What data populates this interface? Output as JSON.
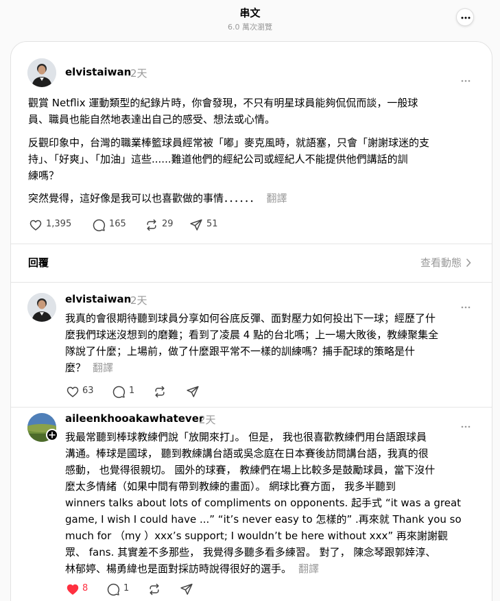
{
  "header": {
    "title": "串文",
    "views": "6.0 萬次瀏覽"
  },
  "post": {
    "username": "elvistaiwan",
    "time": "2天",
    "paragraphs": [
      [
        "觀賞 Netflix 運動類型的紀錄片時，你會發現，不只有明星球員能夠侃侃而談，一般球",
        "員、職員也能自然地表達出自己的感受、想法或心情。"
      ],
      [
        "反觀印象中，台灣的職業棒籃球員經常被「嘟」麥克風時，就語塞，只會「謝謝球迷的支",
        "持」、「好爽」、「加油」這些......難道他們的經紀公司或經紀人不能提供他們講話的訓",
        "練嗎？"
      ],
      [
        "突然覺得，這好像是我可以也喜歡做的事情．．．．．．"
      ]
    ],
    "translate": "翻譯",
    "likes": "1,395",
    "comments": "165",
    "reposts": "29",
    "shares": "51"
  },
  "replies_section": {
    "label": "回覆",
    "activity": "查看動態"
  },
  "replies": [
    {
      "username": "elvistaiwan",
      "time": "2天",
      "lines": [
        "我真的會很期待聽到球員分享如何谷底反彈、面對壓力如何投出下一球；經歷了什",
        "麼我們球迷沒想到的磨難；看到了凌晨 4 點的台北嗎；上一場大敗後，教練聚集全",
        "隊說了什麼；上場前，做了什麼跟平常不一樣的訓練嗎？捕手配球的策略是什",
        "麼？"
      ],
      "translate": "翻譯",
      "likes": "63",
      "comments": "1"
    },
    {
      "username": "aileenkhooakawhatever",
      "time": "2天",
      "lines": [
        "我最常聽到棒球教練們說「放開來打」。 但是， 我也很喜歡教練們用台語跟球員",
        "溝通。棒球是國球， 聽到教練講台語或吳念庭在日本賽後訪問講台語，我真的很",
        "感動， 也覺得很親切。 國外的球賽， 教練們在場上比較多是鼓勵球員，當下沒什",
        "麼太多情緒（如果中間有帶到教練的畫面）。 網球比賽方面， 我多半聽到",
        "winners talks about lots of compliments on opponents. 起手式 “it was a great",
        "game, I wish I could have ...” “it’s never easy to 怎樣的” .再來就 Thank you so",
        "much for （my ）xxx’s support; I wouldn’t be here without xxx” 再來謝謝觀",
        "眾、 fans. 其實差不多那些， 我覺得多聽多看多練習。 對了， 陳念琴跟郭婞淳、",
        "林郁婷、楊勇緯也是面對採訪時說得很好的選手。"
      ],
      "translate": "翻譯",
      "likes": "8",
      "comments": "1"
    }
  ],
  "icons": {
    "more": "more-horizontal-icon",
    "heart": "heart-icon",
    "comment": "comment-bubble-icon",
    "repost": "repost-icon",
    "share": "share-send-icon",
    "plus": "follow-plus-icon",
    "chevron": "chevron-right-icon"
  },
  "colors": {
    "liked_heart": "#ff3040",
    "muted_text": "#999999"
  }
}
